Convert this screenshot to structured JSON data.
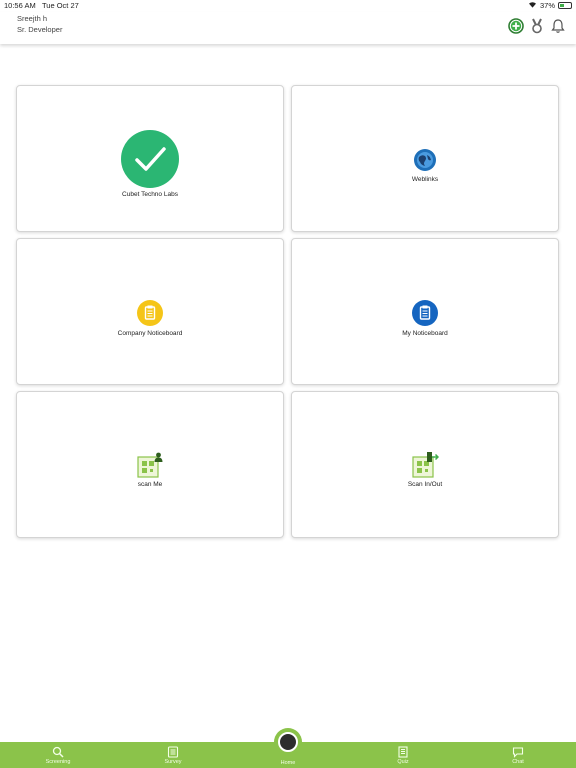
{
  "status": {
    "time": "10:56 AM",
    "date": "Tue Oct 27",
    "battery": "37%",
    "battery_level": 0.37
  },
  "header": {
    "user_name": "Sreejth h",
    "user_role": "Sr. Developer"
  },
  "cards": [
    {
      "label": "Cubet Techno Labs",
      "icon": "check-circle-icon"
    },
    {
      "label": "Weblinks",
      "icon": "globe-icon"
    },
    {
      "label": "Company Noticeboard",
      "icon": "clipboard-icon",
      "color": "#f5c518"
    },
    {
      "label": "My Noticeboard",
      "icon": "clipboard-icon",
      "color": "#1565c0"
    },
    {
      "label": "scan Me",
      "icon": "qr-user-icon"
    },
    {
      "label": "Scan In/Out",
      "icon": "qr-door-icon"
    }
  ],
  "tabs": [
    {
      "label": "Screening",
      "icon": "search-icon"
    },
    {
      "label": "Survey",
      "icon": "list-icon"
    },
    {
      "label": "Home",
      "icon": "home-icon"
    },
    {
      "label": "Quiz",
      "icon": "document-icon"
    },
    {
      "label": "Chat",
      "icon": "chat-icon"
    }
  ],
  "colors": {
    "accent_green": "#8bc34a",
    "check_green": "#2bb673"
  }
}
